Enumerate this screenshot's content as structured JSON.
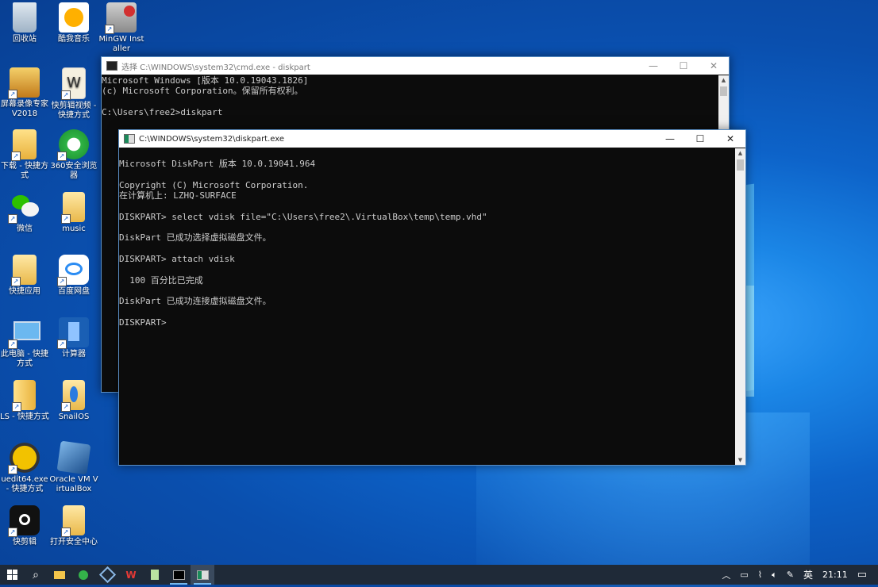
{
  "desktop": {
    "icons": [
      {
        "label": "回收站",
        "icon": "recycle-bin-icon"
      },
      {
        "label": "酷我音乐",
        "icon": "kuwo-music-icon"
      },
      {
        "label": "MinGW Installer",
        "icon": "mingw-installer-icon"
      },
      {
        "label": "屏幕录像专家V2018",
        "icon": "screen-recorder-icon"
      },
      {
        "label": "快剪辑视频 - 快捷方式",
        "icon": "video-editor-icon"
      },
      {
        "label": "下载 - 快捷方式",
        "icon": "downloads-folder-icon"
      },
      {
        "label": "360安全浏览器",
        "icon": "360-browser-icon"
      },
      {
        "label": "微信",
        "icon": "wechat-icon"
      },
      {
        "label": "music",
        "icon": "music-folder-icon"
      },
      {
        "label": "快捷应用",
        "icon": "quick-apps-folder-icon"
      },
      {
        "label": "百度网盘",
        "icon": "baidu-netdisk-icon"
      },
      {
        "label": "此电脑 - 快捷方式",
        "icon": "this-pc-icon"
      },
      {
        "label": "计算器",
        "icon": "calculator-icon"
      },
      {
        "label": "LS - 快捷方式",
        "icon": "ls-folder-icon"
      },
      {
        "label": "SnailOS",
        "icon": "snailos-icon"
      },
      {
        "label": "uedit64.exe - 快捷方式",
        "icon": "ultraedit-icon"
      },
      {
        "label": "Oracle VM VirtualBox",
        "icon": "virtualbox-icon"
      },
      {
        "label": "快剪辑",
        "icon": "kuaijianji-icon"
      },
      {
        "label": "打开安全中心",
        "icon": "security-center-icon"
      }
    ]
  },
  "cmd_window": {
    "title": "选择 C:\\WINDOWS\\system32\\cmd.exe - diskpart",
    "lines": [
      "Microsoft Windows [版本 10.0.19043.1826]",
      "(c) Microsoft Corporation。保留所有权利。",
      "",
      "C:\\Users\\free2>diskpart"
    ]
  },
  "diskpart_window": {
    "title": "C:\\WINDOWS\\system32\\diskpart.exe",
    "lines": [
      "",
      "Microsoft DiskPart 版本 10.0.19041.964",
      "",
      "Copyright (C) Microsoft Corporation.",
      "在计算机上: LZHQ-SURFACE",
      "",
      "DISKPART> select vdisk file=\"C:\\Users\\free2\\.VirtualBox\\temp\\temp.vhd\"",
      "",
      "DiskPart 已成功选择虚拟磁盘文件。",
      "",
      "DISKPART> attach vdisk",
      "",
      "  100 百分比已完成",
      "",
      "DiskPart 已成功连接虚拟磁盘文件。",
      "",
      "DISKPART> "
    ]
  },
  "window_controls": {
    "minimize": "—",
    "maximize": "☐",
    "close": "✕"
  },
  "taskbar": {
    "items": [
      {
        "icon": "windows-start-icon"
      },
      {
        "icon": "search-icon"
      },
      {
        "icon": "file-explorer-icon"
      },
      {
        "icon": "360-browser-icon"
      },
      {
        "icon": "virtualbox-icon"
      },
      {
        "icon": "wps-office-icon"
      },
      {
        "icon": "notepad-icon"
      },
      {
        "icon": "cmd-icon"
      },
      {
        "icon": "diskpart-icon"
      }
    ],
    "tray": {
      "language": "英",
      "time": "21:11"
    }
  },
  "colors": {
    "console_bg": "#0c0c0c",
    "console_fg": "#cccccc",
    "taskbar": "#1f2a38"
  }
}
